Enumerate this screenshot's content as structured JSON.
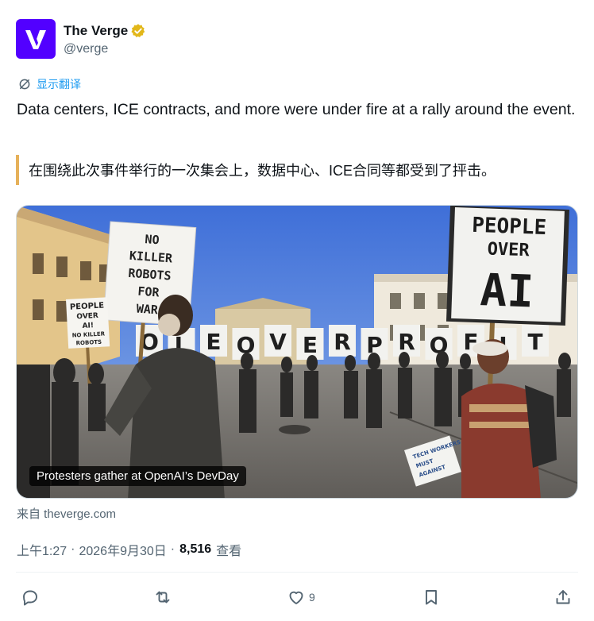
{
  "account": {
    "display_name": "The Verge",
    "handle": "@verge",
    "avatar_icon": "the-verge-logo",
    "brand_color": "#5200ff",
    "verified_color": "#e2b719"
  },
  "translate": {
    "label": "显示翻译",
    "icon": "translate-icon",
    "color": "#1d9bf0"
  },
  "post": {
    "text": "Data centers, ICE contracts, and more were under fire at a rally around the event.",
    "translation": "在围绕此次事件举行的一次集会上，数据中心、ICE合同等都受到了抨击。",
    "translation_accent": "#e6b15a"
  },
  "media": {
    "caption": "Protesters gather at OpenAI’s DevDay",
    "signs": {
      "big": [
        "PEOPLE",
        "OVER",
        "AI"
      ],
      "left": [
        "NO",
        "KILLER",
        "ROBOTS",
        "FOR",
        "WAR"
      ],
      "small": [
        "PEOPLE",
        "OVER",
        "AI!",
        "NO KILLER",
        "ROBOTS"
      ],
      "row": [
        "O",
        "L",
        "E",
        "O",
        "V",
        "E",
        "R",
        "P",
        "R",
        "O",
        "F",
        "I",
        "T"
      ],
      "pamphlet": [
        "TECH WORKERS",
        "MUST",
        "AGAINST"
      ]
    }
  },
  "source": {
    "label": "来自 theverge.com"
  },
  "meta": {
    "time": "上午1:27",
    "separator1": "·",
    "date": "2026年9月30日",
    "separator2": "·",
    "views": "8,516",
    "views_label": "查看"
  },
  "actions": {
    "reply_icon": "reply-icon",
    "repost_icon": "repost-icon",
    "like_icon": "heart-icon",
    "like_count": "9",
    "bookmark_icon": "bookmark-icon",
    "share_icon": "share-icon"
  }
}
